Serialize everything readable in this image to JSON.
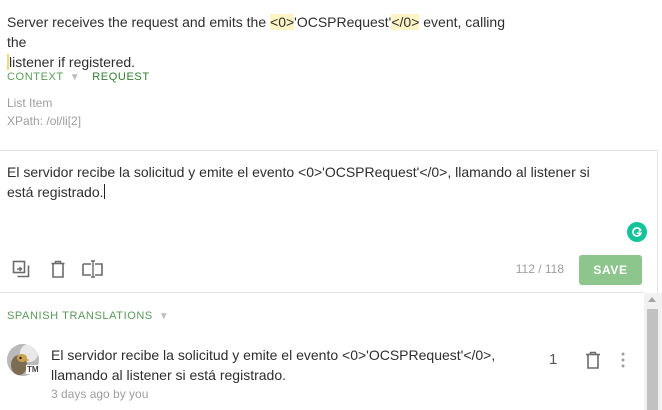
{
  "source": {
    "text_before_tag1": "Server receives the request and emits the ",
    "tag_open": "<0>",
    "tag_middle": "'OCSPRequest'",
    "tag_close": "</0>",
    "text_after_tag": " event, calling the",
    "line2": "listener if registered."
  },
  "meta": {
    "context_label": "CONTEXT",
    "request_label": "REQUEST",
    "context_lines": [
      "List Item",
      "XPath: /ol/li[2]"
    ]
  },
  "editor": {
    "translation": "El servidor recibe la solicitud y emite el evento <0>'OCSPRequest'</0>, llamando al listener si está registrado.",
    "char_count": "112 / 118",
    "save_label": "SAVE"
  },
  "translations_section": {
    "title": "SPANISH TRANSLATIONS",
    "items": [
      {
        "text": "El servidor recibe la solicitud y emite el evento <0>'OCSPRequest'</0>, llamando al listener si está registrado.",
        "meta": "3 days ago by you",
        "votes": "1",
        "badge": "TM"
      }
    ]
  },
  "colors": {
    "accent_green": "#8cc68c",
    "label_green": "#5a9a5a",
    "highlight": "#fdf3c4",
    "grammar_icon": "#15c39a"
  },
  "icons": [
    "copy-source-icon",
    "delete-icon",
    "clear-format-icon",
    "grammar-check-icon",
    "trash-icon",
    "more-vertical-icon",
    "chevron-down-icon",
    "scroll-up-icon"
  ]
}
